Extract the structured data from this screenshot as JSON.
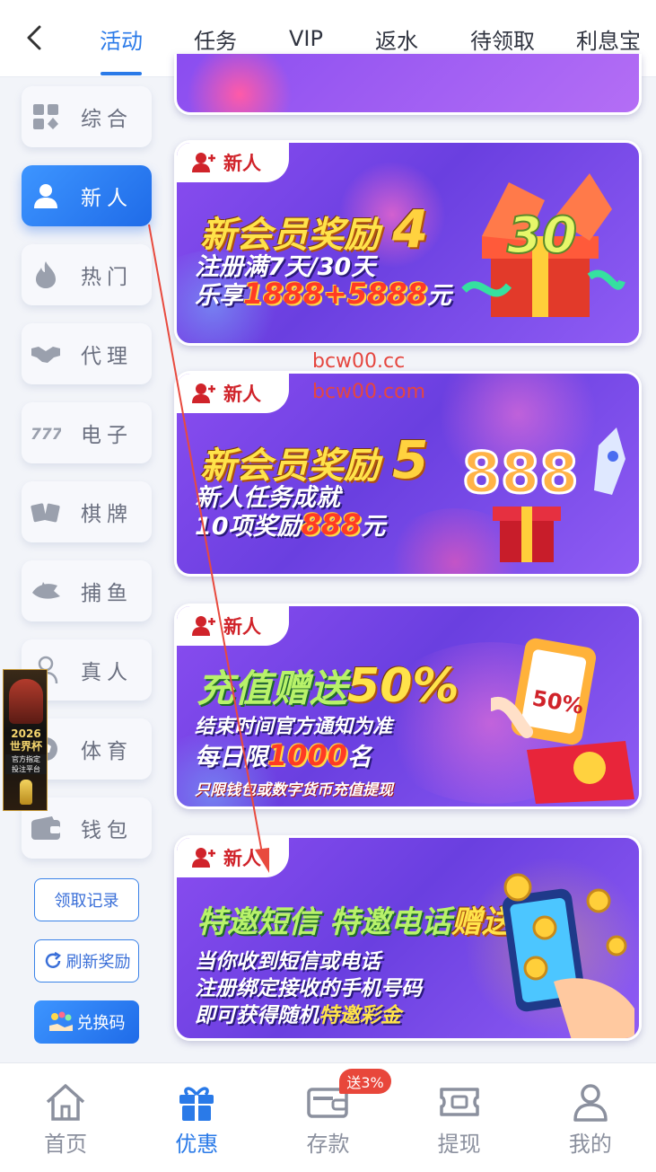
{
  "tabs": [
    "活动",
    "任务",
    "VIP",
    "返水",
    "待领取",
    "利息宝"
  ],
  "active_tab": "活动",
  "sidebar": {
    "items": [
      {
        "label": "综合",
        "icon": "grid-icon"
      },
      {
        "label": "新人",
        "icon": "user-icon"
      },
      {
        "label": "热门",
        "icon": "flame-icon"
      },
      {
        "label": "代理",
        "icon": "handshake-icon"
      },
      {
        "label": "电子",
        "icon": "slot-777-icon"
      },
      {
        "label": "棋牌",
        "icon": "cards-icon"
      },
      {
        "label": "捕鱼",
        "icon": "shark-icon"
      },
      {
        "label": "真人",
        "icon": "person-icon"
      },
      {
        "label": "体育",
        "icon": "ball-icon"
      },
      {
        "label": "钱包",
        "icon": "wallet-icon"
      }
    ],
    "active": "新人",
    "buttons": {
      "records": "领取记录",
      "refresh": "刷新奖励",
      "redeem": "兑换码"
    }
  },
  "float_ad": {
    "year": "2026",
    "title": "世界杯",
    "sub1": "官方指定",
    "sub2": "投注平台"
  },
  "watermark": {
    "line1": "bcw00.cc",
    "line2": "bcw00.com"
  },
  "banners": [
    {
      "tag": "新人",
      "title": "新会员奖励",
      "badge_num": "4",
      "line1": "注册满7天/30天",
      "line2_prefix": "乐享",
      "line2_num": "1888+5888",
      "line2_suffix": "元",
      "art": "30"
    },
    {
      "tag": "新人",
      "title": "新会员奖励",
      "badge_num": "5",
      "line1": "新人任务成就",
      "line2_prefix": "10项奖励",
      "line2_num": "888",
      "line2_suffix": "元",
      "art": "888"
    },
    {
      "tag": "新人",
      "title_a": "充值赠送",
      "title_b": "50%",
      "line1": "结束时间官方通知为准",
      "line2_prefix": "每日限",
      "line2_num": "1000",
      "line2_suffix": "名",
      "line3": "只限钱包或数字货币充值提现",
      "art": "50%"
    },
    {
      "tag": "新人",
      "title_a": "特邀短信",
      "title_b": "特邀电话",
      "title_c": "赠送",
      "line1": "当你收到短信或电话",
      "line2": "注册绑定接收的手机号码",
      "line3_prefix": "即可获得随机",
      "line3_highlight": "特邀彩金"
    }
  ],
  "bottom_nav": [
    {
      "label": "首页",
      "icon": "home-icon"
    },
    {
      "label": "优惠",
      "icon": "gift-icon"
    },
    {
      "label": "存款",
      "icon": "deposit-wallet-icon",
      "badge": "送3%"
    },
    {
      "label": "提现",
      "icon": "withdraw-ticket-icon"
    },
    {
      "label": "我的",
      "icon": "profile-icon"
    }
  ],
  "bottom_active": "优惠",
  "colors": {
    "primary": "#2a7ae8",
    "tag_red": "#d0232a",
    "banner_purple": "#7a46ea"
  }
}
